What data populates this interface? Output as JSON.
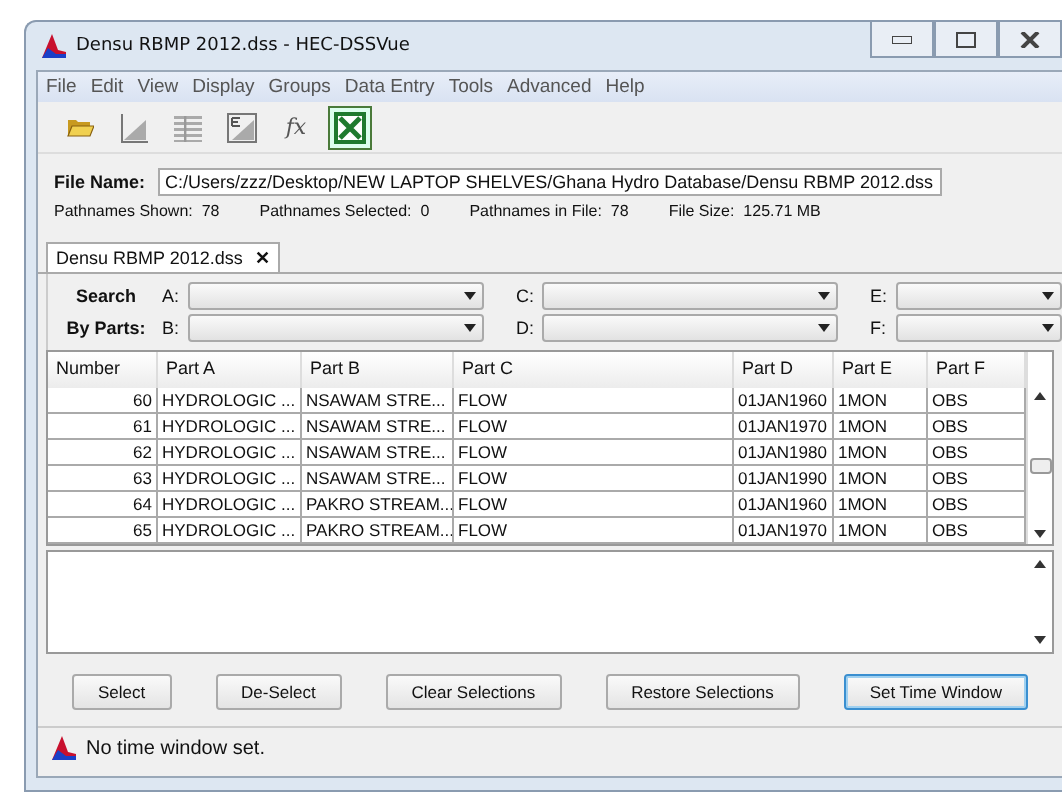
{
  "window": {
    "title": "Densu RBMP 2012.dss - HEC-DSSVue"
  },
  "menu": [
    "File",
    "Edit",
    "View",
    "Display",
    "Groups",
    "Data Entry",
    "Tools",
    "Advanced",
    "Help"
  ],
  "toolbar": [
    {
      "kind": "open"
    },
    {
      "kind": "plot"
    },
    {
      "kind": "table"
    },
    {
      "kind": "edit"
    },
    {
      "kind": "math",
      "label": "fx"
    },
    {
      "kind": "excel",
      "selected": true
    }
  ],
  "file": {
    "label": "File Name:",
    "value": "C:/Users/zzz/Desktop/NEW LAPTOP SHELVES/Ghana Hydro Database/Densu RBMP 2012.dss"
  },
  "stats": [
    {
      "label": "Pathnames Shown:",
      "value": "78"
    },
    {
      "label": "Pathnames Selected:",
      "value": "0"
    },
    {
      "label": "Pathnames in File:",
      "value": "78"
    },
    {
      "label": "File Size:",
      "value": "125.71  MB"
    }
  ],
  "tabs": [
    {
      "label": "Densu RBMP 2012.dss",
      "close": "✕",
      "selected": true
    }
  ],
  "search": {
    "label_1": "Search",
    "label_2": "By Parts:",
    "parts": [
      "A:",
      "C:",
      "E:",
      "B:",
      "D:",
      "F:"
    ]
  },
  "table": {
    "columns": [
      "Number",
      "Part A",
      "Part B",
      "Part C",
      "Part D",
      "Part E",
      "Part F"
    ],
    "rows": [
      [
        "60",
        "HYDROLOGIC ...",
        "NSAWAM STRE...",
        "FLOW",
        "01JAN1960",
        "1MON",
        "OBS"
      ],
      [
        "61",
        "HYDROLOGIC ...",
        "NSAWAM STRE...",
        "FLOW",
        "01JAN1970",
        "1MON",
        "OBS"
      ],
      [
        "62",
        "HYDROLOGIC ...",
        "NSAWAM STRE...",
        "FLOW",
        "01JAN1980",
        "1MON",
        "OBS"
      ],
      [
        "63",
        "HYDROLOGIC ...",
        "NSAWAM STRE...",
        "FLOW",
        "01JAN1990",
        "1MON",
        "OBS"
      ],
      [
        "64",
        "HYDROLOGIC ...",
        "PAKRO STREAM...",
        "FLOW",
        "01JAN1960",
        "1MON",
        "OBS"
      ],
      [
        "65",
        "HYDROLOGIC ...",
        "PAKRO STREAM...",
        "FLOW",
        "01JAN1970",
        "1MON",
        "OBS"
      ]
    ]
  },
  "buttons": [
    {
      "label": "Select",
      "selected": false
    },
    {
      "label": "De-Select",
      "selected": false
    },
    {
      "label": "Clear Selections",
      "selected": false
    },
    {
      "label": "Restore Selections",
      "selected": false
    },
    {
      "label": "Set Time Window",
      "selected": true
    }
  ],
  "status_bar": "No time window set."
}
